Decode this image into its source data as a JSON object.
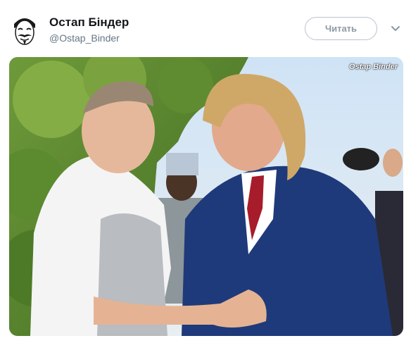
{
  "tweet": {
    "author_name": "Остап Бiндер",
    "author_handle": "@Ostap_Binder",
    "follow_label": "Читать",
    "avatar_icon": "guy-fawkes-mask-icon",
    "menu_icon": "chevron-down-icon"
  },
  "media": {
    "watermark": "Ostap Binder",
    "description_icon": "photo-dancing-couple"
  },
  "colors": {
    "name": "#14171a",
    "handle": "#657786",
    "button_border": "#b9c3cc",
    "button_text": "#8f9aa3"
  }
}
